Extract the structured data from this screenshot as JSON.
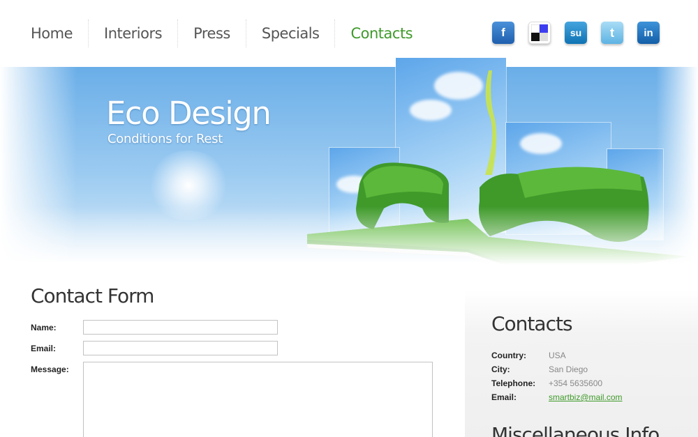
{
  "nav": {
    "items": [
      {
        "label": "Home"
      },
      {
        "label": "Interiors"
      },
      {
        "label": "Press"
      },
      {
        "label": "Specials"
      },
      {
        "label": "Contacts"
      }
    ],
    "active_index": 4,
    "active_color": "#3f9a2a"
  },
  "social": [
    {
      "icon": "facebook-icon",
      "glyph": "f",
      "color": "#1f6fbd"
    },
    {
      "icon": "delicious-icon",
      "glyph": "",
      "color": "#222222"
    },
    {
      "icon": "stumbleupon-icon",
      "glyph": "su",
      "color": "#1b87c9"
    },
    {
      "icon": "twitter-icon",
      "glyph": "t",
      "color": "#7ec5ec"
    },
    {
      "icon": "linkedin-icon",
      "glyph": "in",
      "color": "#1a72c0"
    }
  ],
  "hero": {
    "title": "Eco Design",
    "subtitle": "Conditions for Rest"
  },
  "form": {
    "title": "Contact Form",
    "name_label": "Name:",
    "email_label": "Email:",
    "message_label": "Message:",
    "name_value": "",
    "email_value": "",
    "message_value": ""
  },
  "contacts": {
    "title": "Contacts",
    "rows": [
      {
        "key": "Country:",
        "value": "USA"
      },
      {
        "key": "City:",
        "value": "San Diego"
      },
      {
        "key": "Telephone:",
        "value": "+354 5635600"
      },
      {
        "key": "Email:",
        "value": "smartbiz@mail.com"
      }
    ]
  },
  "misc": {
    "title": "Miscellaneous Info"
  },
  "colors": {
    "accent": "#3f9a2a",
    "text_dark": "#333333",
    "text_muted": "#888888",
    "sky": "#6aaee8",
    "grass": "#3e9a2a"
  }
}
